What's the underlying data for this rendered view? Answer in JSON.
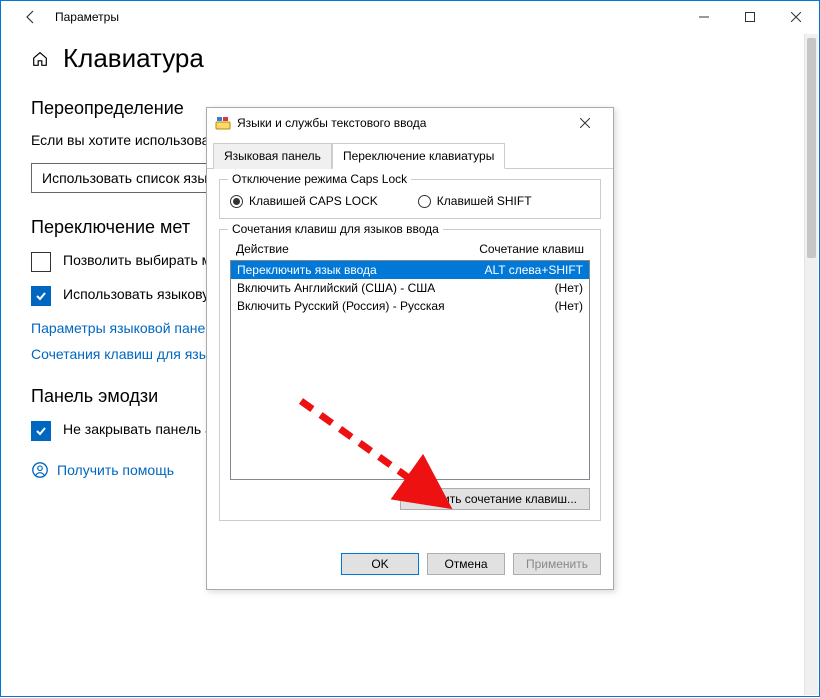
{
  "window": {
    "title": "Параметры"
  },
  "page": {
    "title": "Клавиатура",
    "sections": {
      "override": {
        "heading": "Переопределение",
        "intro": "Если вы хотите использовать первом месте в вашем спи",
        "dropdown": "Использовать список язы"
      },
      "switch": {
        "heading": "Переключение мет",
        "chk1": "Позволить выбирать м приложения",
        "chk2": "Использовать языкову доступна",
        "link1": "Параметры языковой пане",
        "link2": "Сочетания клавиш для язы"
      },
      "emoji": {
        "heading": "Панель эмодзи",
        "chk": "Не закрывать панель автоматически после ввода эмодзи"
      }
    },
    "help": "Получить помощь"
  },
  "dialog": {
    "title": "Языки и службы текстового ввода",
    "tabs": {
      "langbar": "Языковая панель",
      "switching": "Переключение клавиатуры"
    },
    "capslock": {
      "legend": "Отключение режима Caps Lock",
      "opt1": "Клавишей CAPS LOCK",
      "opt2": "Клавишей SHIFT"
    },
    "hotkeys": {
      "legend": "Сочетания клавиш для языков ввода",
      "col_action": "Действие",
      "col_combo": "Сочетание клавиш",
      "rows": [
        {
          "action": "Переключить язык ввода",
          "combo": "ALT слева+SHIFT",
          "selected": true
        },
        {
          "action": "Включить Английский (США) - США",
          "combo": "(Нет)",
          "selected": false
        },
        {
          "action": "Включить Русский (Россия) - Русская",
          "combo": "(Нет)",
          "selected": false
        }
      ],
      "change_btn": "Сменить сочетание клавиш..."
    },
    "footer": {
      "ok": "OK",
      "cancel": "Отмена",
      "apply": "Применить"
    }
  }
}
